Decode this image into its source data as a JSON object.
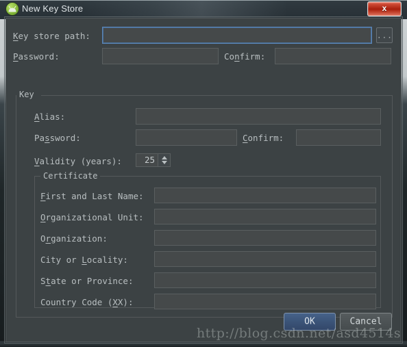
{
  "window": {
    "title": "New Key Store",
    "app_icon": "android-studio-icon",
    "close_label": "x"
  },
  "keystore": {
    "path_label_pre": "",
    "path_label_mnemonic": "K",
    "path_label_post": "ey store path:",
    "path_value": "",
    "browse_label": "...",
    "password_label_mnemonic": "P",
    "password_label_post": "assword:",
    "password_value": "",
    "confirm_label_pre": "Co",
    "confirm_label_mnemonic": "n",
    "confirm_label_post": "firm:",
    "confirm_value": ""
  },
  "key_group": {
    "title": "Key",
    "alias_label_mnemonic": "A",
    "alias_label_post": "lias:",
    "alias_value": "",
    "password_label_pre": "Pa",
    "password_label_mnemonic": "s",
    "password_label_post": "sword:",
    "password_value": "",
    "confirm_label_mnemonic": "C",
    "confirm_label_post": "onfirm:",
    "confirm_value": "",
    "validity_label_mnemonic": "V",
    "validity_label_post": "alidity (years):",
    "validity_value": "25"
  },
  "certificate": {
    "title": "Certificate",
    "rows": [
      {
        "label_pre": "",
        "label_mnemonic": "F",
        "label_post": "irst and Last Name:",
        "value": ""
      },
      {
        "label_pre": "",
        "label_mnemonic": "O",
        "label_post": "rganizational Unit:",
        "value": ""
      },
      {
        "label_pre": "O",
        "label_mnemonic": "r",
        "label_post": "ganization:",
        "value": ""
      },
      {
        "label_pre": "City or ",
        "label_mnemonic": "L",
        "label_post": "ocality:",
        "value": ""
      },
      {
        "label_pre": "S",
        "label_mnemonic": "t",
        "label_post": "ate or Province:",
        "value": ""
      },
      {
        "label_pre": "Country Code (",
        "label_mnemonic": "X",
        "label_post": "X):",
        "value": ""
      }
    ]
  },
  "footer": {
    "ok_label": "OK",
    "cancel_label": "Cancel"
  },
  "watermark": {
    "text": "http://blog.csdn.net/asd4514s"
  },
  "colors": {
    "dialog_background": "#3c4244",
    "titlebar": "#2c353b",
    "field_background": "#45494a",
    "field_border": "#5a5f60",
    "focus_border": "#5b85b5",
    "close_button": "#a81f0d",
    "ok_button": "#3b5478",
    "text": "#b9bfc1"
  }
}
